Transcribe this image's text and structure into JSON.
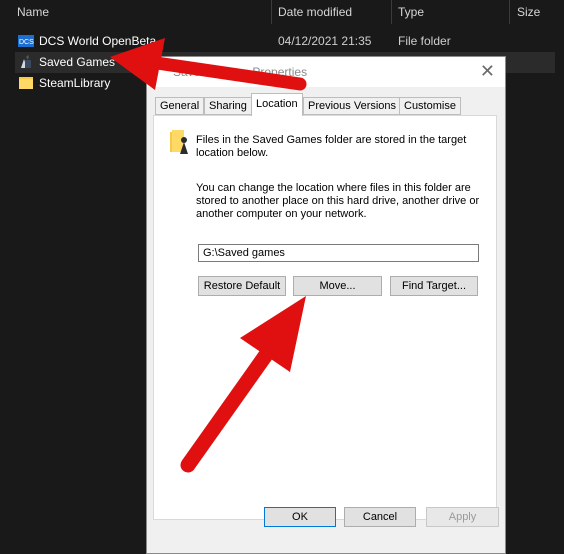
{
  "explorer": {
    "columns": {
      "name": "Name",
      "date": "Date modified",
      "type": "Type",
      "size": "Size"
    },
    "rows": [
      {
        "name": "DCS World OpenBeta",
        "date": "04/12/2021 21:35",
        "type": "File folder"
      },
      {
        "name": "Saved Games",
        "date": "",
        "type": ""
      },
      {
        "name": "SteamLibrary",
        "date": "",
        "type": ""
      }
    ]
  },
  "dialog": {
    "title": "Saved Games Properties",
    "close": "✕",
    "tabs": [
      "General",
      "Sharing",
      "Location",
      "Previous Versions",
      "Customise"
    ],
    "active_tab": "Location",
    "info_text": "Files in the Saved Games folder are stored in the target location below.",
    "desc_text": "You can change the location where files in this folder are stored to another place on this hard drive, another drive or another computer on your network.",
    "path_value": "G:\\Saved games",
    "buttons": {
      "restore": "Restore Default",
      "move": "Move...",
      "find": "Find Target..."
    },
    "footer": {
      "ok": "OK",
      "cancel": "Cancel",
      "apply": "Apply"
    }
  },
  "colors": {
    "arrow": "#e01010",
    "background": "#191919",
    "selection": "#2b2b2b"
  },
  "icons": [
    "dcs-folder-icon",
    "saved-games-icon",
    "folder-icon",
    "close-icon"
  ]
}
